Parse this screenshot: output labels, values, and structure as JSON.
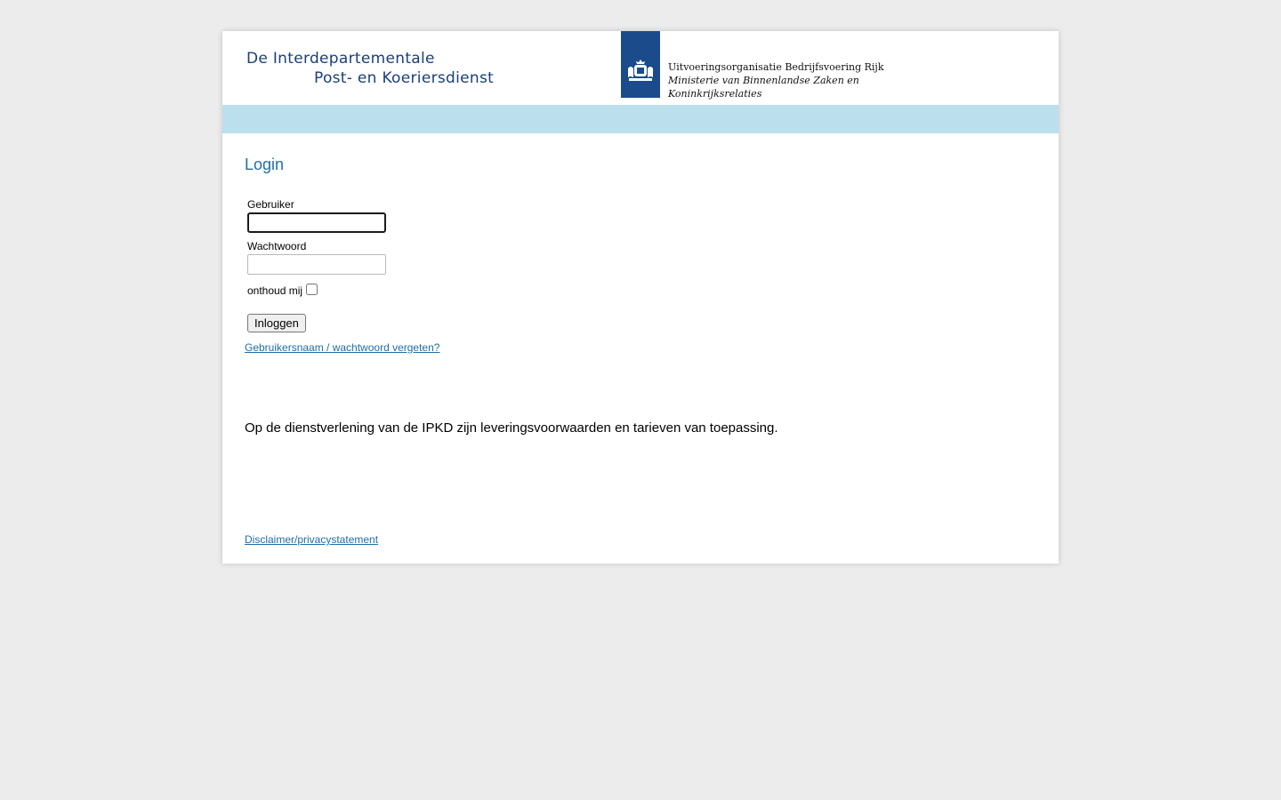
{
  "header": {
    "title_line1": "De Interdepartementale",
    "title_line2": "Post- en Koeriersdienst",
    "logo_icon": "coat-of-arms-icon",
    "org_name": "Uitvoeringsorganisatie Bedrijfsvoering Rijk",
    "ministry_line1": "Ministerie van Binnenlandse Zaken en",
    "ministry_line2": "Koninkrijksrelaties"
  },
  "login": {
    "heading": "Login",
    "user_label": "Gebruiker",
    "user_value": "",
    "password_label": "Wachtwoord",
    "password_value": "",
    "remember_label": "onthoud mij",
    "remember_checked": false,
    "submit_label": "Inloggen",
    "forgot_link": "Gebruikersnaam / wachtwoord vergeten?"
  },
  "terms_text": "Op de dienstverlening van de IPKD zijn leveringsvoorwaarden en tarieven van toepassing.",
  "footer": {
    "disclaimer_link": "Disclaimer/privacystatement"
  },
  "colors": {
    "background": "#ececec",
    "nav_bar": "#bcdfee",
    "heading": "#1f6fa5",
    "title": "#1a3f7a",
    "logo_blue": "#1b4b8a"
  }
}
